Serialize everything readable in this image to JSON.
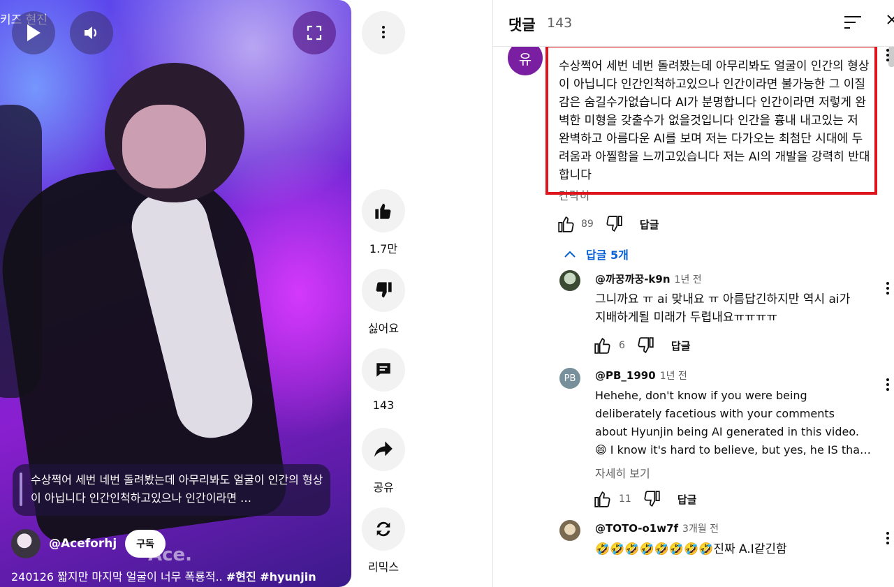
{
  "video": {
    "top_left_text": "키즈 현진",
    "overlay_comment": "수상쩍어 세번 네번 돌려봤는데 아무리봐도 얼굴이 인간의 형상이 아닙니다 인간인척하고있으나 인간이라면 …",
    "channel_handle": "@Aceforhj",
    "subscribe_label": "구독",
    "watermark": "Ace.",
    "title_plain": "240126 짧지만 마지막 얼굴이 너무 폭룡적.. ",
    "title_tags": "#현진 #hyunjin"
  },
  "actions": {
    "like_count": "1.7만",
    "dislike_label": "싫어요",
    "comment_count": "143",
    "share_label": "공유",
    "remix_label": "리믹스"
  },
  "comments_panel": {
    "title": "댓글",
    "count": "143",
    "top_comment": {
      "avatar_letter": "유",
      "text": "수상쩍어 세번 네번 돌려봤는데 아무리봐도 얼굴이 인간의 형상이 아닙니다 인간인척하고있으나 인간이라면 불가능한 그 이질감은 숨길수가없습니다 AI가 분명합니다 인간이라면 저렇게 완벽한 미형을 갖출수가 없을것입니다 인간을 흉내 내고있는 저 완벽하고 아름다운 AI를 보며 저는 다가오는 최첨단 시대에 두려움과 아찔함을 느끼고있습니다 저는 AI의 개발을 강력히 반대합니다",
      "partial_below": "간략히",
      "likes": "89",
      "reply_label": "답글"
    },
    "replies_toggle": "답글 5개",
    "replies": [
      {
        "handle": "@까꿍까꿍-k9n",
        "time": "1년 전",
        "text_lines": [
          "그니까요 ㅠ ai 맞내요 ㅠ 아름답긴하지만 역시 ai가",
          "지배하게될 미래가 두렵내요ㅠㅠㅠㅠ"
        ],
        "likes": "6",
        "reply_label": "답글"
      },
      {
        "avatar_letters": "PB",
        "handle": "@PB_1990",
        "time": "1년 전",
        "text_lines": [
          "Hehehe, don't know if you were being",
          "deliberately facetious with your comments",
          "about Hyunjin being AI generated in this video.",
          "😄 I know it's hard to believe, but yes, he IS tha…"
        ],
        "see_more": "자세히 보기",
        "likes": "11",
        "reply_label": "답글"
      },
      {
        "handle": "@TOTO-o1w7f",
        "time": "3개월 전",
        "text": "🤣🤣🤣🤣🤣🤣🤣🤣진짜 A.I같긴함"
      }
    ]
  },
  "colors": {
    "highlight_box": "#e0141c",
    "link_blue": "#065fd4",
    "avatar_purple": "#7b1fa2",
    "avatar_pb": "#78909c"
  }
}
